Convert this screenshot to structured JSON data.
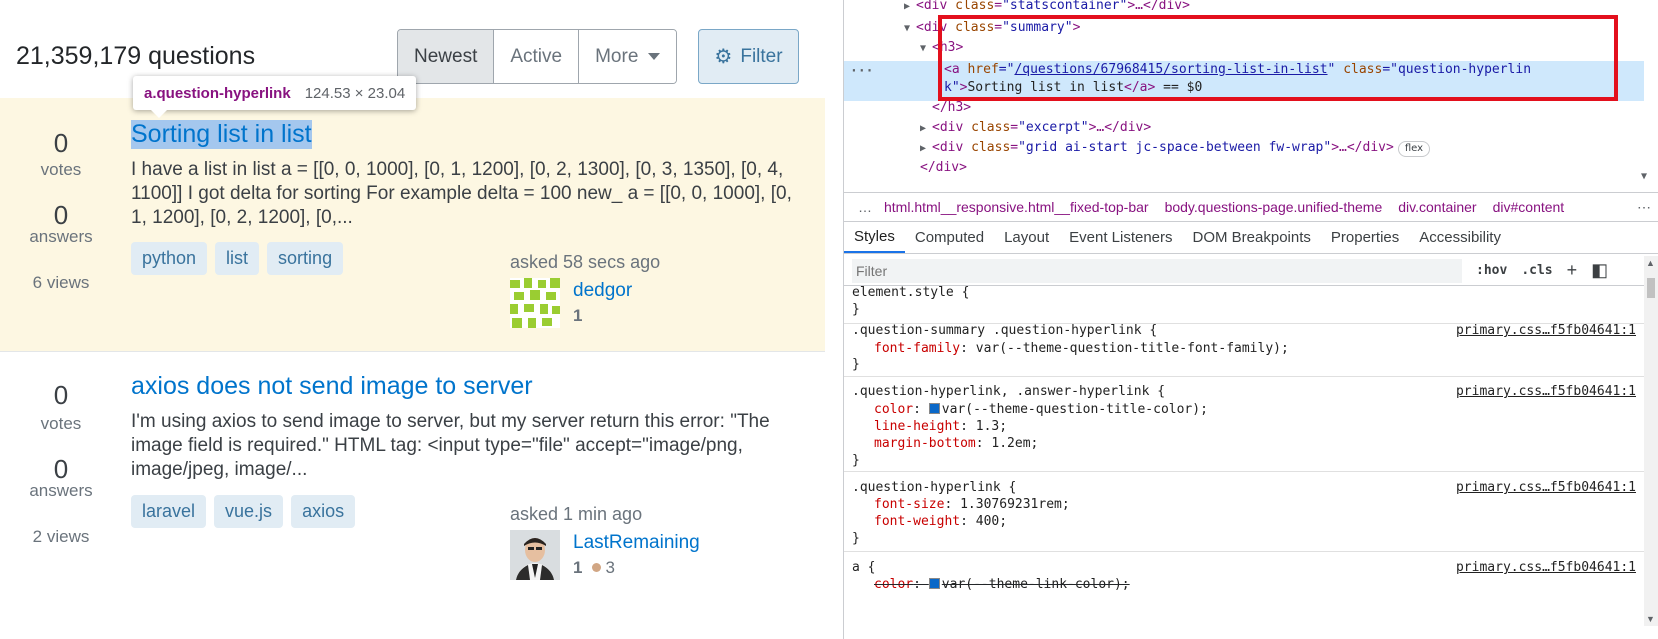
{
  "so": {
    "question_count": "21,359,179 questions",
    "sort_tabs": [
      {
        "label": "Newest"
      },
      {
        "label": "Active"
      },
      {
        "label": "More"
      }
    ],
    "filter_label": "Filter",
    "tooltip": {
      "selector": "a.question-hyperlink",
      "dims": "124.53 × 23.04"
    },
    "questions": [
      {
        "votes": "0",
        "votes_label": "votes",
        "answers": "0",
        "answers_label": "answers",
        "views": "6 views",
        "title": "Sorting list in list",
        "excerpt": "I have a list in list a = [[0, 0, 1000], [0, 1, 1200], [0, 2, 1300], [0, 3, 1350], [0, 4, 1100]] I got delta for sorting For example delta = 100 new_ a = [[0, 0, 1000], [0, 1, 1200], [0, 2, 1200], [0,...",
        "tags": [
          "python",
          "list",
          "sorting"
        ],
        "asked": "asked 58 secs ago",
        "user": "dedgor",
        "rep": "1"
      },
      {
        "votes": "0",
        "votes_label": "votes",
        "answers": "0",
        "answers_label": "answers",
        "views": "2 views",
        "title": "axios does not send image to server",
        "excerpt": "I'm using axios to send image to server, but my server return this error: \"The image field is required.\" HTML tag: <input type=\"file\" accept=\"image/png, image/jpeg, image/...",
        "tags": [
          "laravel",
          "vue.js",
          "axios"
        ],
        "asked": "asked 1 min ago",
        "user": "LastRemaining",
        "rep": "1",
        "bronze": "3"
      }
    ]
  },
  "devtools": {
    "elements": {
      "line0": {
        "open": "<div ",
        "attr": "class",
        "val": "\"statscontainer\"",
        "close": ">…</div>"
      },
      "line1": {
        "open": "<div ",
        "attr": "class",
        "val": "\"summary\"",
        "close": ">"
      },
      "line2": {
        "tag": "<h3>"
      },
      "line3a": {
        "open": "<a ",
        "attr1": "href",
        "eq": "=\"",
        "href": "/questions/67968415/sorting-list-in-list",
        "q": "\" ",
        "attr2": "class",
        "val2": "=\"question-hyperlin"
      },
      "line3b": {
        "cont": "k\"",
        "close1": ">",
        "text": "Sorting list in list",
        "close2": "</a>",
        "eqs": " == $0"
      },
      "line4": {
        "tag": "</h3>"
      },
      "line5": {
        "open": "<div ",
        "attr": "class",
        "val": "\"excerpt\"",
        "close": ">…</div>"
      },
      "line6": {
        "open": "<div ",
        "attr": "class",
        "val": "\"grid ai-start jc-space-between fw-wrap\"",
        "close": ">…</div>",
        "badge": "flex"
      },
      "line7": {
        "tag": "</div>"
      },
      "gutter_dots": "···"
    },
    "breadcrumbs": [
      "html.html__responsive.html__fixed-top-bar",
      "body.questions-page.unified-theme",
      "div.container",
      "div#content"
    ],
    "tabs": [
      "Styles",
      "Computed",
      "Layout",
      "Event Listeners",
      "DOM Breakpoints",
      "Properties",
      "Accessibility"
    ],
    "filter_placeholder": "Filter",
    "filter_tools": {
      "hov": ":hov",
      "cls": ".cls",
      "plus": "+"
    },
    "rules": [
      {
        "selector": "element.style {",
        "close": "}"
      },
      {
        "selector": ".question-summary .question-hyperlink {",
        "source": "primary.css…f5fb04641:1",
        "props": [
          {
            "name": "font-family",
            "value": "var(--theme-question-title-font-family);"
          }
        ],
        "close": "}"
      },
      {
        "selector": ".question-hyperlink, .answer-hyperlink {",
        "source": "primary.css…f5fb04641:1",
        "props": [
          {
            "name": "color",
            "value": "var(--theme-question-title-color);"
          },
          {
            "name": "line-height",
            "value": "1.3;"
          },
          {
            "name": "margin-bottom",
            "value": "1.2em;"
          }
        ],
        "close": "}"
      },
      {
        "selector": ".question-hyperlink {",
        "source": "primary.css…f5fb04641:1",
        "props": [
          {
            "name": "font-size",
            "value": "1.30769231rem;"
          },
          {
            "name": "font-weight",
            "value": "400;"
          }
        ],
        "close": "}"
      },
      {
        "selector": "a {",
        "source": "primary.css…f5fb04641:1",
        "props": [
          {
            "name": "color",
            "value": "var(--theme-link-color);"
          }
        ]
      }
    ],
    "colors": {
      "swatch": "#0a68c8",
      "selection": "#cfe8fc",
      "red_box": "#e3101d"
    }
  }
}
